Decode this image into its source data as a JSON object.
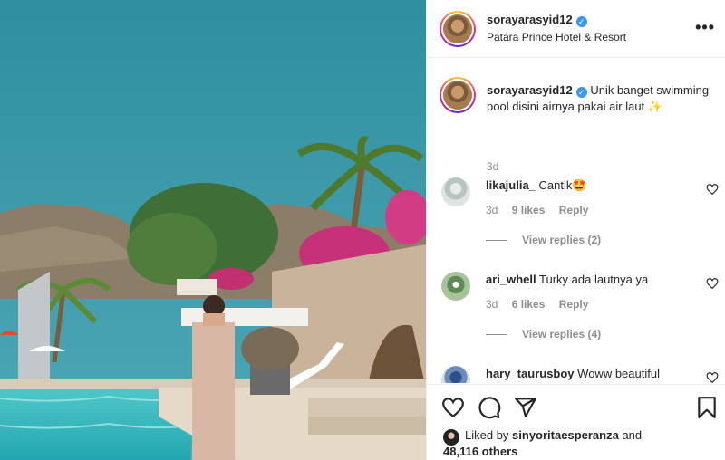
{
  "post": {
    "username": "sorayarasyid12",
    "verified_glyph": "✓",
    "location": "Patara Prince Hotel & Resort",
    "more_glyph": "•••"
  },
  "caption": {
    "username": "sorayarasyid12",
    "text": "Unik banget swimming pool disini airnya pakai air laut ✨",
    "time": "3d"
  },
  "comments": [
    {
      "username": "likajulia_",
      "text": "Cantik🤩",
      "time": "3d",
      "likes": "9 likes",
      "reply": "Reply",
      "view_replies": "View replies (2)"
    },
    {
      "username": "ari_whell",
      "text": "Turky ada lautnya ya",
      "time": "3d",
      "likes": "6 likes",
      "reply": "Reply",
      "view_replies": "View replies (4)"
    },
    {
      "username": "hary_taurusboy",
      "text": "Woww beautiful"
    }
  ],
  "likes": {
    "prefix": "Liked by",
    "user": "sinyoritaesperanza",
    "and": "and",
    "count": "48,116 others"
  },
  "icons": [
    "more-icon",
    "verified-icon",
    "heart-icon",
    "comment-icon",
    "share-icon",
    "bookmark-icon"
  ],
  "colors": {
    "verified": "#3897f0",
    "meta": "#8e8e8e",
    "text": "#262626"
  }
}
